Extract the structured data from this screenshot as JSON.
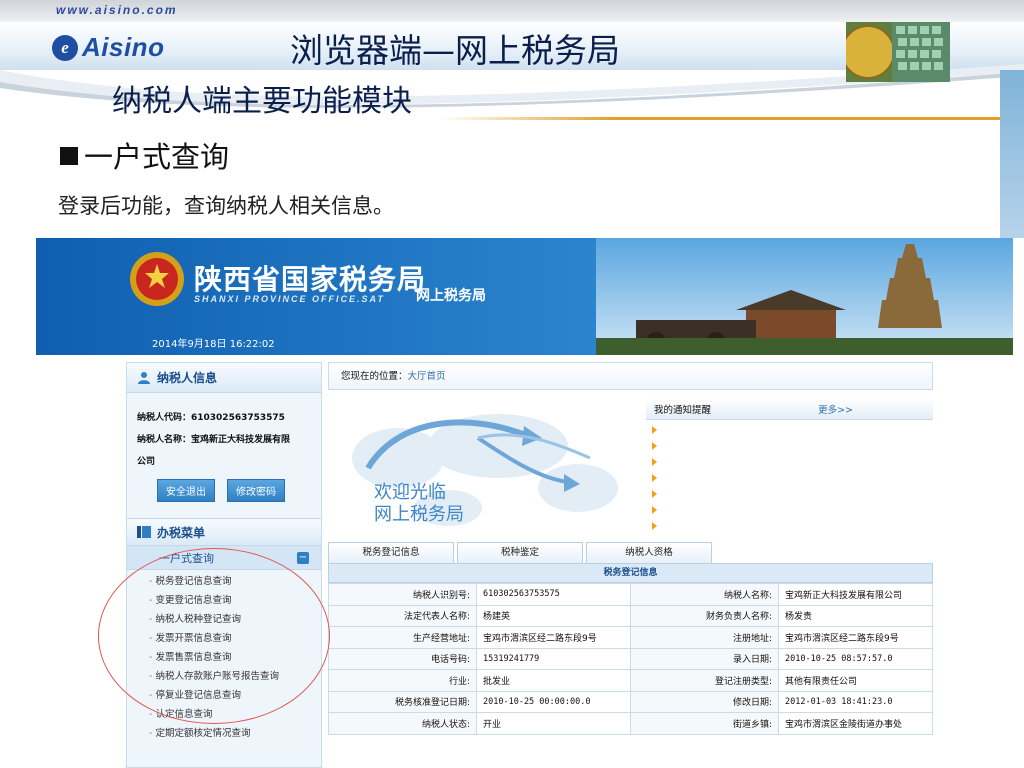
{
  "slide": {
    "url_text": "www.aisino.com",
    "logo_text": "Aisino",
    "title": "浏览器端—网上税务局",
    "subtitle": "纳税人端主要功能模块",
    "bullet_heading": "一户式查询",
    "bullet_desc": "登录后功能，查询纳税人相关信息。"
  },
  "site": {
    "name_cn": "陕西省国家税务局",
    "name_en": "SHANXI PROVINCE OFFICE.SAT",
    "subtitle": "网上税务局",
    "datetime": "2014年9月18日 16:22:02"
  },
  "sidebar": {
    "header": "纳税人信息",
    "taxpayer_code_line": "纳税人代码：610302563753575",
    "taxpayer_name_line1": "纳税人名称：宝鸡新正大科技发展有限",
    "taxpayer_name_line2": "公司",
    "logout_button": "安全退出",
    "change_password_button": "修改密码",
    "menu_header": "办税菜单",
    "group_label": "一户式查询",
    "items": [
      "税务登记信息查询",
      "变更登记信息查询",
      "纳税人税种登记查询",
      "发票开票信息查询",
      "发票售票信息查询",
      "纳税人存款账户账号报告查询",
      "停复业登记信息查询",
      "认定信息查询",
      "定期定额核定情况查询"
    ]
  },
  "main": {
    "breadcrumb_prefix": "您现在的位置：",
    "breadcrumb_current": "大厅首页",
    "welcome_line1": "欢迎光临",
    "welcome_line2": "网上税务局",
    "notice_title": "我的通知提醒",
    "notice_more": "更多>>",
    "tabs": [
      "税务登记信息",
      "税种鉴定",
      "纳税人资格"
    ],
    "table_caption": "税务登记信息",
    "rows": [
      {
        "l1": "纳税人识别号:",
        "v1": "610302563753575",
        "l2": "纳税人名称:",
        "v2": "宝鸡新正大科技发展有限公司"
      },
      {
        "l1": "法定代表人名称:",
        "v1": "杨建英",
        "l2": "财务负责人名称:",
        "v2": "杨发贵"
      },
      {
        "l1": "生产经营地址:",
        "v1": "宝鸡市渭滨区经二路东段9号",
        "l2": "注册地址:",
        "v2": "宝鸡市渭滨区经二路东段9号"
      },
      {
        "l1": "电话号码:",
        "v1": "15319241779",
        "l2": "录入日期:",
        "v2": "2010-10-25 08:57:57.0"
      },
      {
        "l1": "行业:",
        "v1": "批发业",
        "l2": "登记注册类型:",
        "v2": "其他有限责任公司"
      },
      {
        "l1": "税务核准登记日期:",
        "v1": "2010-10-25 00:00:00.0",
        "l2": "修改日期:",
        "v2": "2012-01-03 18:41:23.0"
      },
      {
        "l1": "纳税人状态:",
        "v1": "开业",
        "l2": "街道乡镇:",
        "v2": "宝鸡市渭滨区金陵街道办事处"
      }
    ]
  },
  "colors": {
    "brand_blue": "#1f4fa3",
    "banner_blue": "#0f5fb0",
    "annotation_red": "#e0554f",
    "accent_gold": "#e2a02b"
  }
}
